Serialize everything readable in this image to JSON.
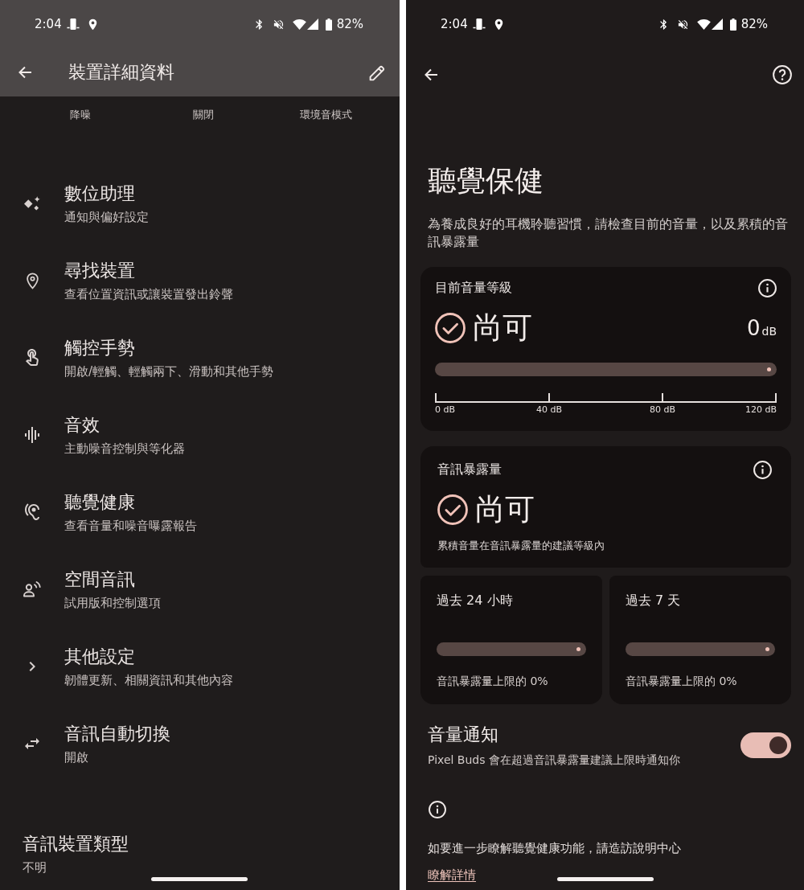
{
  "left_screen": {
    "status_bar": {
      "time": "2:04",
      "battery": "82%"
    },
    "app_bar": {
      "title": "裝置詳細資料"
    },
    "mode_labels": [
      "降噪",
      "關閉",
      "環境音模式"
    ],
    "settings": [
      {
        "title": "數位助理",
        "subtitle": "通知與偏好設定"
      },
      {
        "title": "尋找裝置",
        "subtitle": "查看位置資訊或讓裝置發出鈴聲"
      },
      {
        "title": "觸控手勢",
        "subtitle": "開啟/輕觸、輕觸兩下、滑動和其他手勢"
      },
      {
        "title": "音效",
        "subtitle": "主動噪音控制與等化器"
      },
      {
        "title": "聽覺健康",
        "subtitle": "查看音量和噪音曝露報告"
      },
      {
        "title": "空間音訊",
        "subtitle": "試用版和控制選項"
      },
      {
        "title": "其他設定",
        "subtitle": "韌體更新、相關資訊和其他內容"
      },
      {
        "title": "音訊自動切換",
        "subtitle": "開啟"
      }
    ],
    "device_type": {
      "title": "音訊裝置類型",
      "value": "不明"
    }
  },
  "right_screen": {
    "status_bar": {
      "time": "2:04",
      "battery": "82%"
    },
    "title": "聽覺保健",
    "description": "為養成良好的耳機聆聽習慣，請檢查目前的音量，以及累積的音訊暴露量",
    "current_level_card": {
      "label": "目前音量等級",
      "status": "尚可",
      "reading": "0",
      "unit": "dB",
      "scale": [
        "0 dB",
        "40 dB",
        "80 dB",
        "120 dB"
      ]
    },
    "exposure_card": {
      "label": "音訊暴露量",
      "status": "尚可",
      "note": "累積音量在音訊暴露量的建議等級內"
    },
    "periods": [
      {
        "label": "過去 24 小時",
        "caption": "音訊暴露量上限的 0%"
      },
      {
        "label": "過去 7 天",
        "caption": "音訊暴露量上限的 0%"
      }
    ],
    "notification": {
      "title": "音量通知",
      "subtitle": "Pixel Buds 會在超過音訊暴露量建議上限時通知你",
      "on": true
    },
    "help": {
      "text": "如要進一步瞭解聽覺健康功能，請造訪說明中心",
      "link": "瞭解詳情"
    }
  }
}
